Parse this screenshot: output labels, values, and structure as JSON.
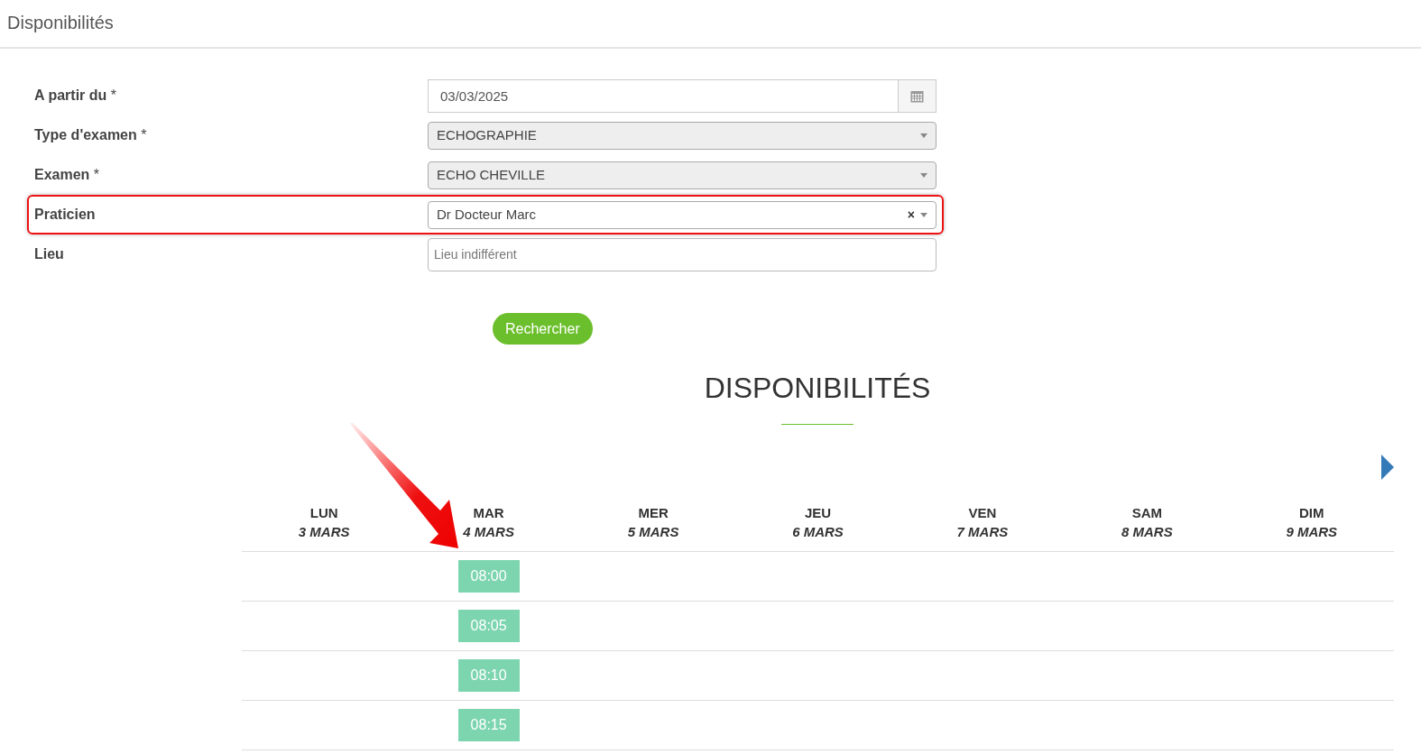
{
  "page_title": "Disponibilités",
  "form": [
    {
      "label": "A partir du",
      "required": true,
      "kind": "date",
      "value": "03/03/2025",
      "highlighted": false
    },
    {
      "label": "Type d'examen",
      "required": true,
      "kind": "select",
      "value": "ECHOGRAPHIE",
      "highlighted": false
    },
    {
      "label": "Examen",
      "required": true,
      "kind": "select",
      "value": "ECHO CHEVILLE",
      "highlighted": false
    },
    {
      "label": "Praticien",
      "required": false,
      "kind": "select-clear",
      "value": "Dr Docteur Marc",
      "clear": "×",
      "highlighted": true
    },
    {
      "label": "Lieu",
      "required": false,
      "kind": "text",
      "placeholder": "Lieu indifférent",
      "highlighted": false
    }
  ],
  "required_mark": "*",
  "search_button": "Rechercher",
  "section_title": "DISPONIBILITÉS",
  "days": [
    {
      "day": "LUN",
      "date": "3 MARS"
    },
    {
      "day": "MAR",
      "date": "4 MARS",
      "slots": [
        "08:00",
        "08:05",
        "08:10",
        "08:15"
      ]
    },
    {
      "day": "MER",
      "date": "5 MARS"
    },
    {
      "day": "JEU",
      "date": "6 MARS"
    },
    {
      "day": "VEN",
      "date": "7 MARS"
    },
    {
      "day": "SAM",
      "date": "8 MARS"
    },
    {
      "day": "DIM",
      "date": "9 MARS"
    }
  ],
  "annotation_arrow": true
}
